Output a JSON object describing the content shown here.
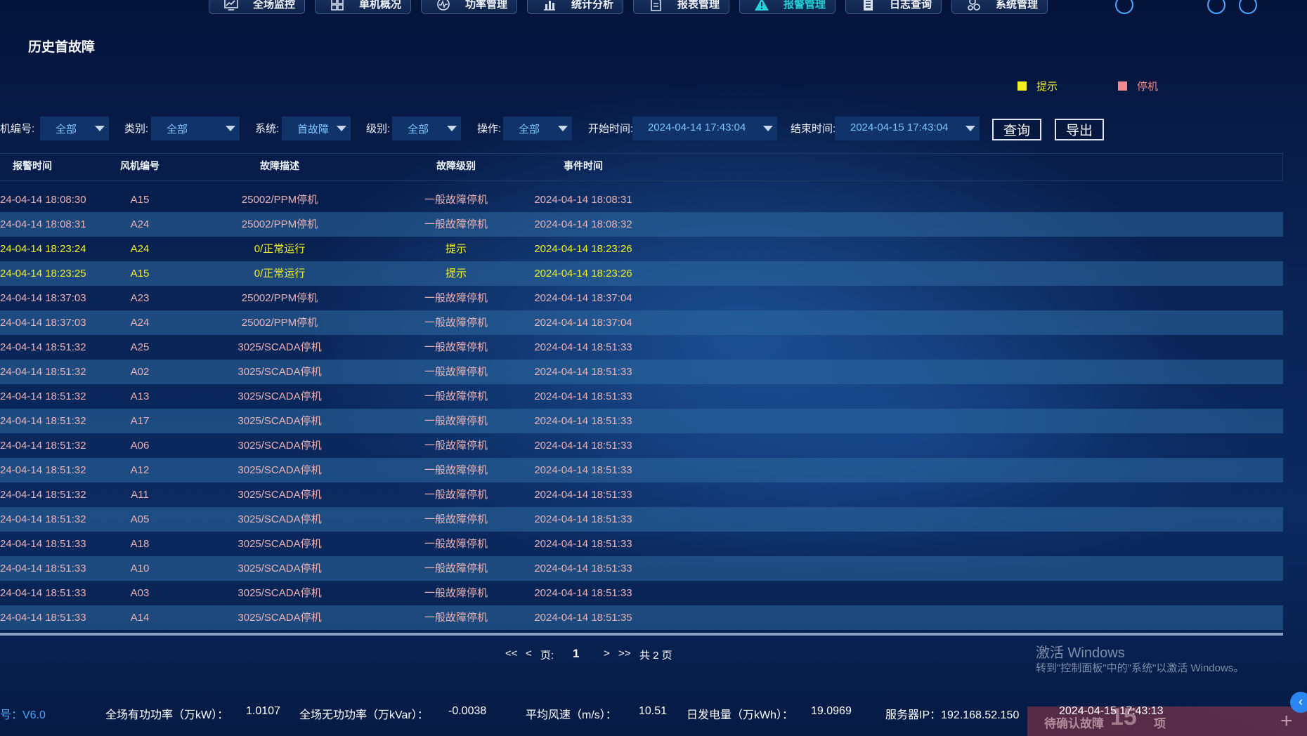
{
  "nav": [
    {
      "label": "全场监控",
      "icon": "monitor-chart-icon",
      "active": false
    },
    {
      "label": "单机概况",
      "icon": "grid-icon",
      "active": false
    },
    {
      "label": "功率管理",
      "icon": "power-gauge-icon",
      "active": false
    },
    {
      "label": "统计分析",
      "icon": "bar-chart-icon",
      "active": false
    },
    {
      "label": "报表管理",
      "icon": "document-icon",
      "active": false
    },
    {
      "label": "报警管理",
      "icon": "warning-icon",
      "active": true
    },
    {
      "label": "日志查询",
      "icon": "log-icon",
      "active": false
    },
    {
      "label": "系统管理",
      "icon": "settings-people-icon",
      "active": false
    }
  ],
  "page_title": "历史首故障",
  "legend": [
    {
      "label": "提示",
      "color": "#f2ef25"
    },
    {
      "label": "停机",
      "color": "#f08a8e"
    }
  ],
  "filters": {
    "turbine_label": "机编号:",
    "turbine_value": "全部",
    "category_label": "类别:",
    "category_value": "全部",
    "system_label": "系统:",
    "system_value": "首故障",
    "level_label": "级别:",
    "level_value": "全部",
    "operation_label": "操作:",
    "operation_value": "全部",
    "start_label": "开始时间:",
    "start_value": "2024-04-14 17:43:04",
    "end_label": "结束时间:",
    "end_value": "2024-04-15 17:43:04",
    "query_button": "查询",
    "export_button": "导出"
  },
  "table": {
    "headers": [
      "报警时间",
      "风机编号",
      "故障描述",
      "故障级别",
      "事件时间"
    ],
    "rows": [
      {
        "alarm_time": "24-04-14 18:08:30",
        "turbine": "A15",
        "desc": "25002/PPM停机",
        "level": "一般故障停机",
        "event_time": "2024-04-14 18:08:31",
        "type": "stop"
      },
      {
        "alarm_time": "24-04-14 18:08:31",
        "turbine": "A24",
        "desc": "25002/PPM停机",
        "level": "一般故障停机",
        "event_time": "2024-04-14 18:08:32",
        "type": "stop"
      },
      {
        "alarm_time": "24-04-14 18:23:24",
        "turbine": "A24",
        "desc": "0/正常运行",
        "level": "提示",
        "event_time": "2024-04-14 18:23:26",
        "type": "hint"
      },
      {
        "alarm_time": "24-04-14 18:23:25",
        "turbine": "A15",
        "desc": "0/正常运行",
        "level": "提示",
        "event_time": "2024-04-14 18:23:26",
        "type": "hint"
      },
      {
        "alarm_time": "24-04-14 18:37:03",
        "turbine": "A23",
        "desc": "25002/PPM停机",
        "level": "一般故障停机",
        "event_time": "2024-04-14 18:37:04",
        "type": "stop"
      },
      {
        "alarm_time": "24-04-14 18:37:03",
        "turbine": "A24",
        "desc": "25002/PPM停机",
        "level": "一般故障停机",
        "event_time": "2024-04-14 18:37:04",
        "type": "stop"
      },
      {
        "alarm_time": "24-04-14 18:51:32",
        "turbine": "A25",
        "desc": "3025/SCADA停机",
        "level": "一般故障停机",
        "event_time": "2024-04-14 18:51:33",
        "type": "stop"
      },
      {
        "alarm_time": "24-04-14 18:51:32",
        "turbine": "A02",
        "desc": "3025/SCADA停机",
        "level": "一般故障停机",
        "event_time": "2024-04-14 18:51:33",
        "type": "stop"
      },
      {
        "alarm_time": "24-04-14 18:51:32",
        "turbine": "A13",
        "desc": "3025/SCADA停机",
        "level": "一般故障停机",
        "event_time": "2024-04-14 18:51:33",
        "type": "stop"
      },
      {
        "alarm_time": "24-04-14 18:51:32",
        "turbine": "A17",
        "desc": "3025/SCADA停机",
        "level": "一般故障停机",
        "event_time": "2024-04-14 18:51:33",
        "type": "stop"
      },
      {
        "alarm_time": "24-04-14 18:51:32",
        "turbine": "A06",
        "desc": "3025/SCADA停机",
        "level": "一般故障停机",
        "event_time": "2024-04-14 18:51:33",
        "type": "stop"
      },
      {
        "alarm_time": "24-04-14 18:51:32",
        "turbine": "A12",
        "desc": "3025/SCADA停机",
        "level": "一般故障停机",
        "event_time": "2024-04-14 18:51:33",
        "type": "stop"
      },
      {
        "alarm_time": "24-04-14 18:51:32",
        "turbine": "A11",
        "desc": "3025/SCADA停机",
        "level": "一般故障停机",
        "event_time": "2024-04-14 18:51:33",
        "type": "stop"
      },
      {
        "alarm_time": "24-04-14 18:51:32",
        "turbine": "A05",
        "desc": "3025/SCADA停机",
        "level": "一般故障停机",
        "event_time": "2024-04-14 18:51:33",
        "type": "stop"
      },
      {
        "alarm_time": "24-04-14 18:51:33",
        "turbine": "A18",
        "desc": "3025/SCADA停机",
        "level": "一般故障停机",
        "event_time": "2024-04-14 18:51:33",
        "type": "stop"
      },
      {
        "alarm_time": "24-04-14 18:51:33",
        "turbine": "A10",
        "desc": "3025/SCADA停机",
        "level": "一般故障停机",
        "event_time": "2024-04-14 18:51:33",
        "type": "stop"
      },
      {
        "alarm_time": "24-04-14 18:51:33",
        "turbine": "A03",
        "desc": "3025/SCADA停机",
        "level": "一般故障停机",
        "event_time": "2024-04-14 18:51:33",
        "type": "stop"
      },
      {
        "alarm_time": "24-04-14 18:51:33",
        "turbine": "A14",
        "desc": "3025/SCADA停机",
        "level": "一般故障停机",
        "event_time": "2024-04-14 18:51:35",
        "type": "stop"
      }
    ]
  },
  "pager": {
    "first": "<<",
    "prev": "<",
    "page_label": "页:",
    "current": "1",
    "next": ">",
    "last": ">>",
    "total": "共 2 页"
  },
  "watermark": {
    "line1": "激活 Windows",
    "line2": "转到\"控制面板\"中的\"系统\"以激活 Windows。"
  },
  "footer": {
    "version": "号：V6.0",
    "active_power_label": "全场有功功率（万kW）：",
    "active_power": "1.0107",
    "reactive_power_label": "全场无功功率（万kVar）：",
    "reactive_power": "-0.0038",
    "wind_label": "平均风速（m/s）：",
    "wind": "10.51",
    "energy_label": "日发电量（万kWh）：",
    "energy": "19.0969",
    "server_ip": "服务器IP：192.168.52.150",
    "datetime": "2024-04-15 17:43:13",
    "pending_label": "待确认故障",
    "pending_count": "15",
    "pending_unit": "项"
  }
}
